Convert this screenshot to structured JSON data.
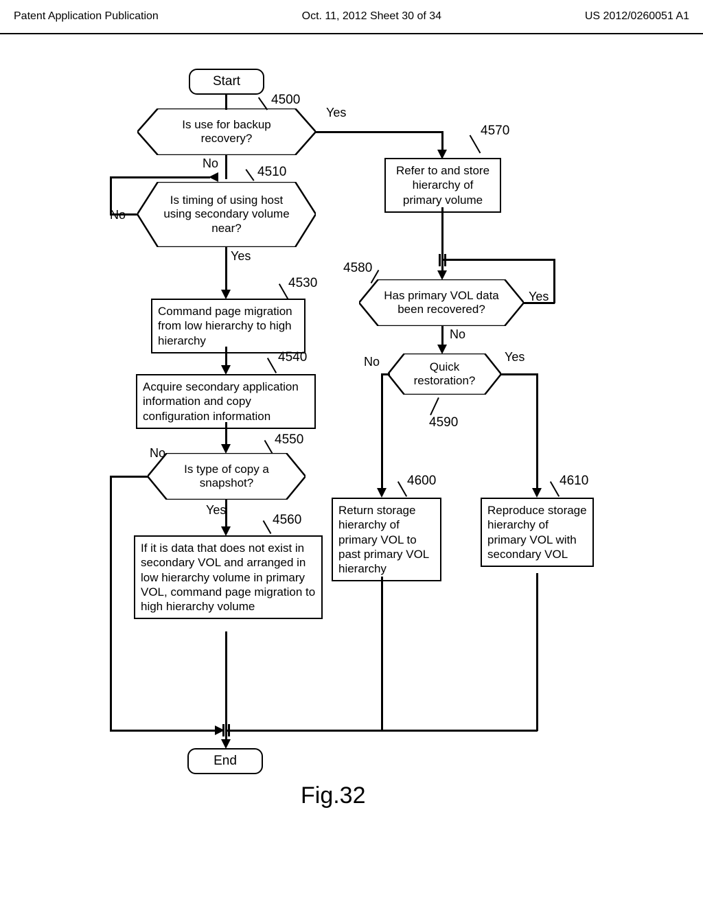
{
  "header": {
    "left": "Patent Application Publication",
    "mid": "Oct. 11, 2012  Sheet 30 of 34",
    "right": "US 2012/0260051 A1"
  },
  "nodes": {
    "start": "Start",
    "end": "End",
    "d4500": "Is use for backup recovery?",
    "d4510": "Is timing of using host using secondary volume near?",
    "p4530": "Command page migration from low hierarchy to high hierarchy",
    "p4540": "Acquire secondary application information and copy configuration information",
    "d4550": "Is type of copy a snapshot?",
    "p4560": "If it is data that does not exist in secondary VOL and arranged in low hierarchy volume in primary VOL, command page migration to high hierarchy volume",
    "p4570": "Refer to and store hierarchy of primary volume",
    "d4580": "Has primary VOL data been recovered?",
    "d4590": "Quick restoration?",
    "p4600": "Return storage hierarchy of primary VOL to past primary VOL hierarchy",
    "p4610": "Reproduce storage hierarchy of primary VOL with secondary VOL"
  },
  "refs": {
    "r4500": "4500",
    "r4510": "4510",
    "r4530": "4530",
    "r4540": "4540",
    "r4550": "4550",
    "r4560": "4560",
    "r4570": "4570",
    "r4580": "4580",
    "r4590": "4590",
    "r4600": "4600",
    "r4610": "4610"
  },
  "labels": {
    "yes": "Yes",
    "no": "No"
  },
  "figure": "Fig.32",
  "chart_data": {
    "type": "flowchart",
    "nodes": [
      {
        "id": "start",
        "type": "terminator",
        "label": "Start"
      },
      {
        "id": "4500",
        "type": "decision",
        "label": "Is use for backup recovery?"
      },
      {
        "id": "4510",
        "type": "decision",
        "label": "Is timing of using host using secondary volume near?"
      },
      {
        "id": "4530",
        "type": "process",
        "label": "Command page migration from low hierarchy to high hierarchy"
      },
      {
        "id": "4540",
        "type": "process",
        "label": "Acquire secondary application information and copy configuration information"
      },
      {
        "id": "4550",
        "type": "decision",
        "label": "Is type of copy a snapshot?"
      },
      {
        "id": "4560",
        "type": "process",
        "label": "If it is data that does not exist in secondary VOL and arranged in low hierarchy volume in primary VOL, command page migration to high hierarchy volume"
      },
      {
        "id": "4570",
        "type": "process",
        "label": "Refer to and store hierarchy of primary volume"
      },
      {
        "id": "4580",
        "type": "decision",
        "label": "Has primary VOL data been recovered?"
      },
      {
        "id": "4590",
        "type": "decision",
        "label": "Quick restoration?"
      },
      {
        "id": "4600",
        "type": "process",
        "label": "Return storage hierarchy of primary VOL to past primary VOL hierarchy"
      },
      {
        "id": "4610",
        "type": "process",
        "label": "Reproduce storage hierarchy of primary VOL with secondary VOL"
      },
      {
        "id": "end",
        "type": "terminator",
        "label": "End"
      }
    ],
    "edges": [
      {
        "from": "start",
        "to": "4500"
      },
      {
        "from": "4500",
        "to": "4570",
        "label": "Yes"
      },
      {
        "from": "4500",
        "to": "4510",
        "label": "No"
      },
      {
        "from": "4510",
        "to": "4510",
        "label": "No",
        "loop": true
      },
      {
        "from": "4510",
        "to": "4530",
        "label": "Yes"
      },
      {
        "from": "4530",
        "to": "4540"
      },
      {
        "from": "4540",
        "to": "4550"
      },
      {
        "from": "4550",
        "to": "end",
        "label": "No"
      },
      {
        "from": "4550",
        "to": "4560",
        "label": "Yes"
      },
      {
        "from": "4560",
        "to": "end"
      },
      {
        "from": "4570",
        "to": "4580"
      },
      {
        "from": "4580",
        "to": "4580",
        "label": "Yes",
        "loop": true
      },
      {
        "from": "4580",
        "to": "4590",
        "label": "No"
      },
      {
        "from": "4590",
        "to": "4600",
        "label": "No"
      },
      {
        "from": "4590",
        "to": "4610",
        "label": "Yes"
      },
      {
        "from": "4600",
        "to": "end"
      },
      {
        "from": "4610",
        "to": "end"
      }
    ]
  }
}
